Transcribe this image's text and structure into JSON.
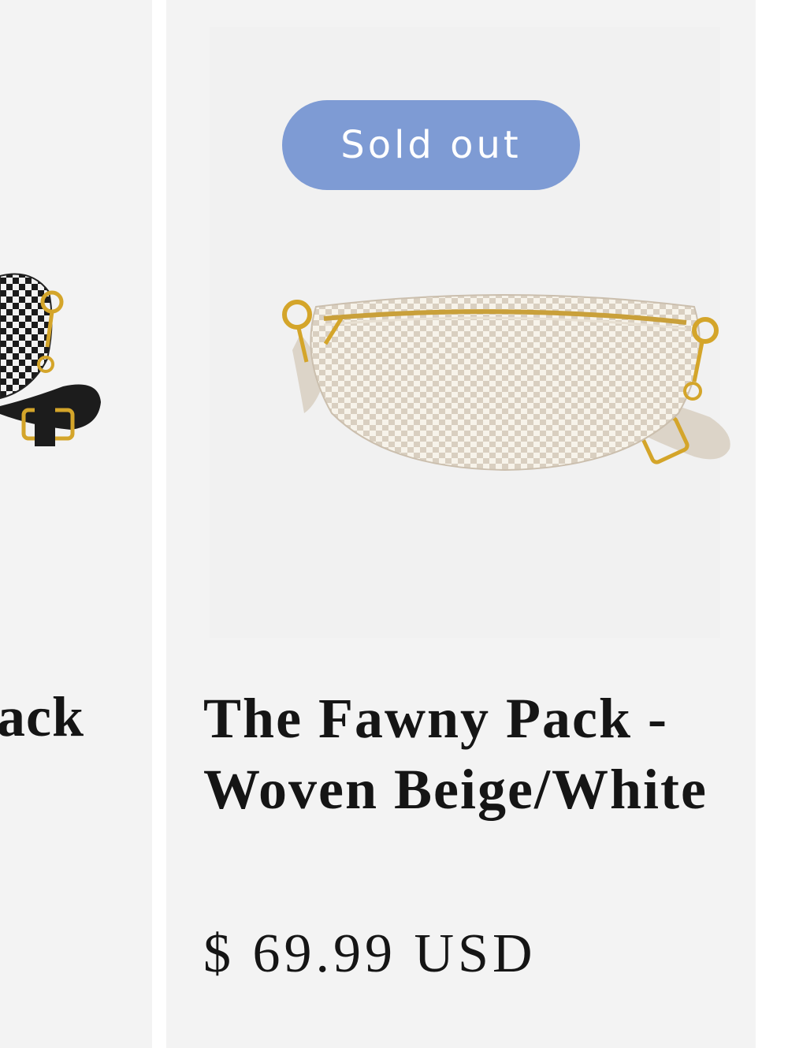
{
  "cards": {
    "left": {
      "title": "ack",
      "image_icon": "black-white-checkered-belt-bag-icon"
    },
    "main": {
      "badge": "Sold out",
      "title": "The Fawny Pack - Woven Beige/White",
      "price": "$ 69.99 USD",
      "image_icon": "beige-woven-belt-bag-icon"
    }
  },
  "colors": {
    "badge_bg": "#7e9bd4",
    "card_bg": "#f3f3f3",
    "text": "#151515"
  }
}
